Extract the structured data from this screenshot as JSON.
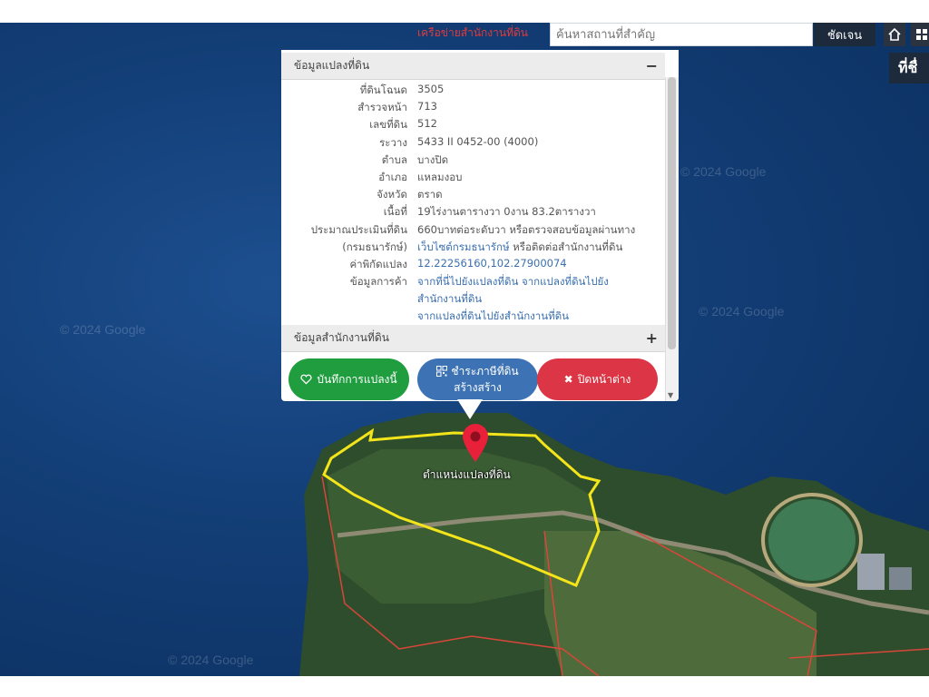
{
  "topbar": {
    "network_link": "เครือข่ายสำนักงานที่ดิน",
    "search_placeholder": "ค้นหาสถานที่สำคัญ",
    "search_button": "ชัดเจน",
    "right_label": "ที่ชื่"
  },
  "map": {
    "watermark": "© 2024 Google",
    "marker_label": "ตำแหน่งแปลงที่ดิน"
  },
  "parcel_section": {
    "title": "ข้อมูลแปลงที่ดิน",
    "toggle": "−",
    "rows": [
      {
        "label": "ที่ดินโฉนด",
        "value": "3505"
      },
      {
        "label": "สำรวจหน้า",
        "value": "713"
      },
      {
        "label": "เลขที่ดิน",
        "value": "512"
      },
      {
        "label": "ระวาง",
        "value": "5433 II 0452-00 (4000)"
      },
      {
        "label": "ตำบล",
        "value": "บางปิด"
      },
      {
        "label": "อำเภอ",
        "value": "แหลมงอบ"
      },
      {
        "label": "จังหวัด",
        "value": "ตราด"
      },
      {
        "label": "เนื้อที่",
        "value": "19ไร่งานตารางวา 0งาน 83.2ตารางวา"
      },
      {
        "label": "ประมาณประเมินที่ดิน",
        "value": "660บาทต่อระดับวา หรือตรวจสอบข้อมูลผ่านทาง"
      },
      {
        "label": "(กรมธนารักษ์)",
        "value_link": "เว็บไซต์กรมธนารักษ์",
        "value_rest": " หรือติดต่อสำนักงานที่ดิน"
      },
      {
        "label": "ค่าพิกัดแปลง",
        "value": "12.22256160,102.27900074"
      },
      {
        "label": "ข้อมูลการค้า",
        "value": "จากที่นี่ไปยังแปลงที่ดิน จากแปลงที่ดินไปยัง"
      },
      {
        "label": "",
        "value": "สำนักงานที่ดิน"
      },
      {
        "label": "",
        "value": "จากแปลงที่ดินไปยังสำนักงานที่ดิน"
      }
    ]
  },
  "office_section": {
    "title": "ข้อมูลสำนักงานที่ดิน",
    "toggle": "+"
  },
  "buttons": {
    "save": "บันทึกการแปลงนี้",
    "pay_line1": "ชำระภาษีที่ดิน",
    "pay_line2": "สร้างสร้าง",
    "close": "ปิดหน้าต่าง"
  },
  "colors": {
    "save": "#1f9d3f",
    "pay": "#3d73b4",
    "close": "#dc3545",
    "parcel_outline": "#f4e51a",
    "marker": "#e8203a"
  }
}
